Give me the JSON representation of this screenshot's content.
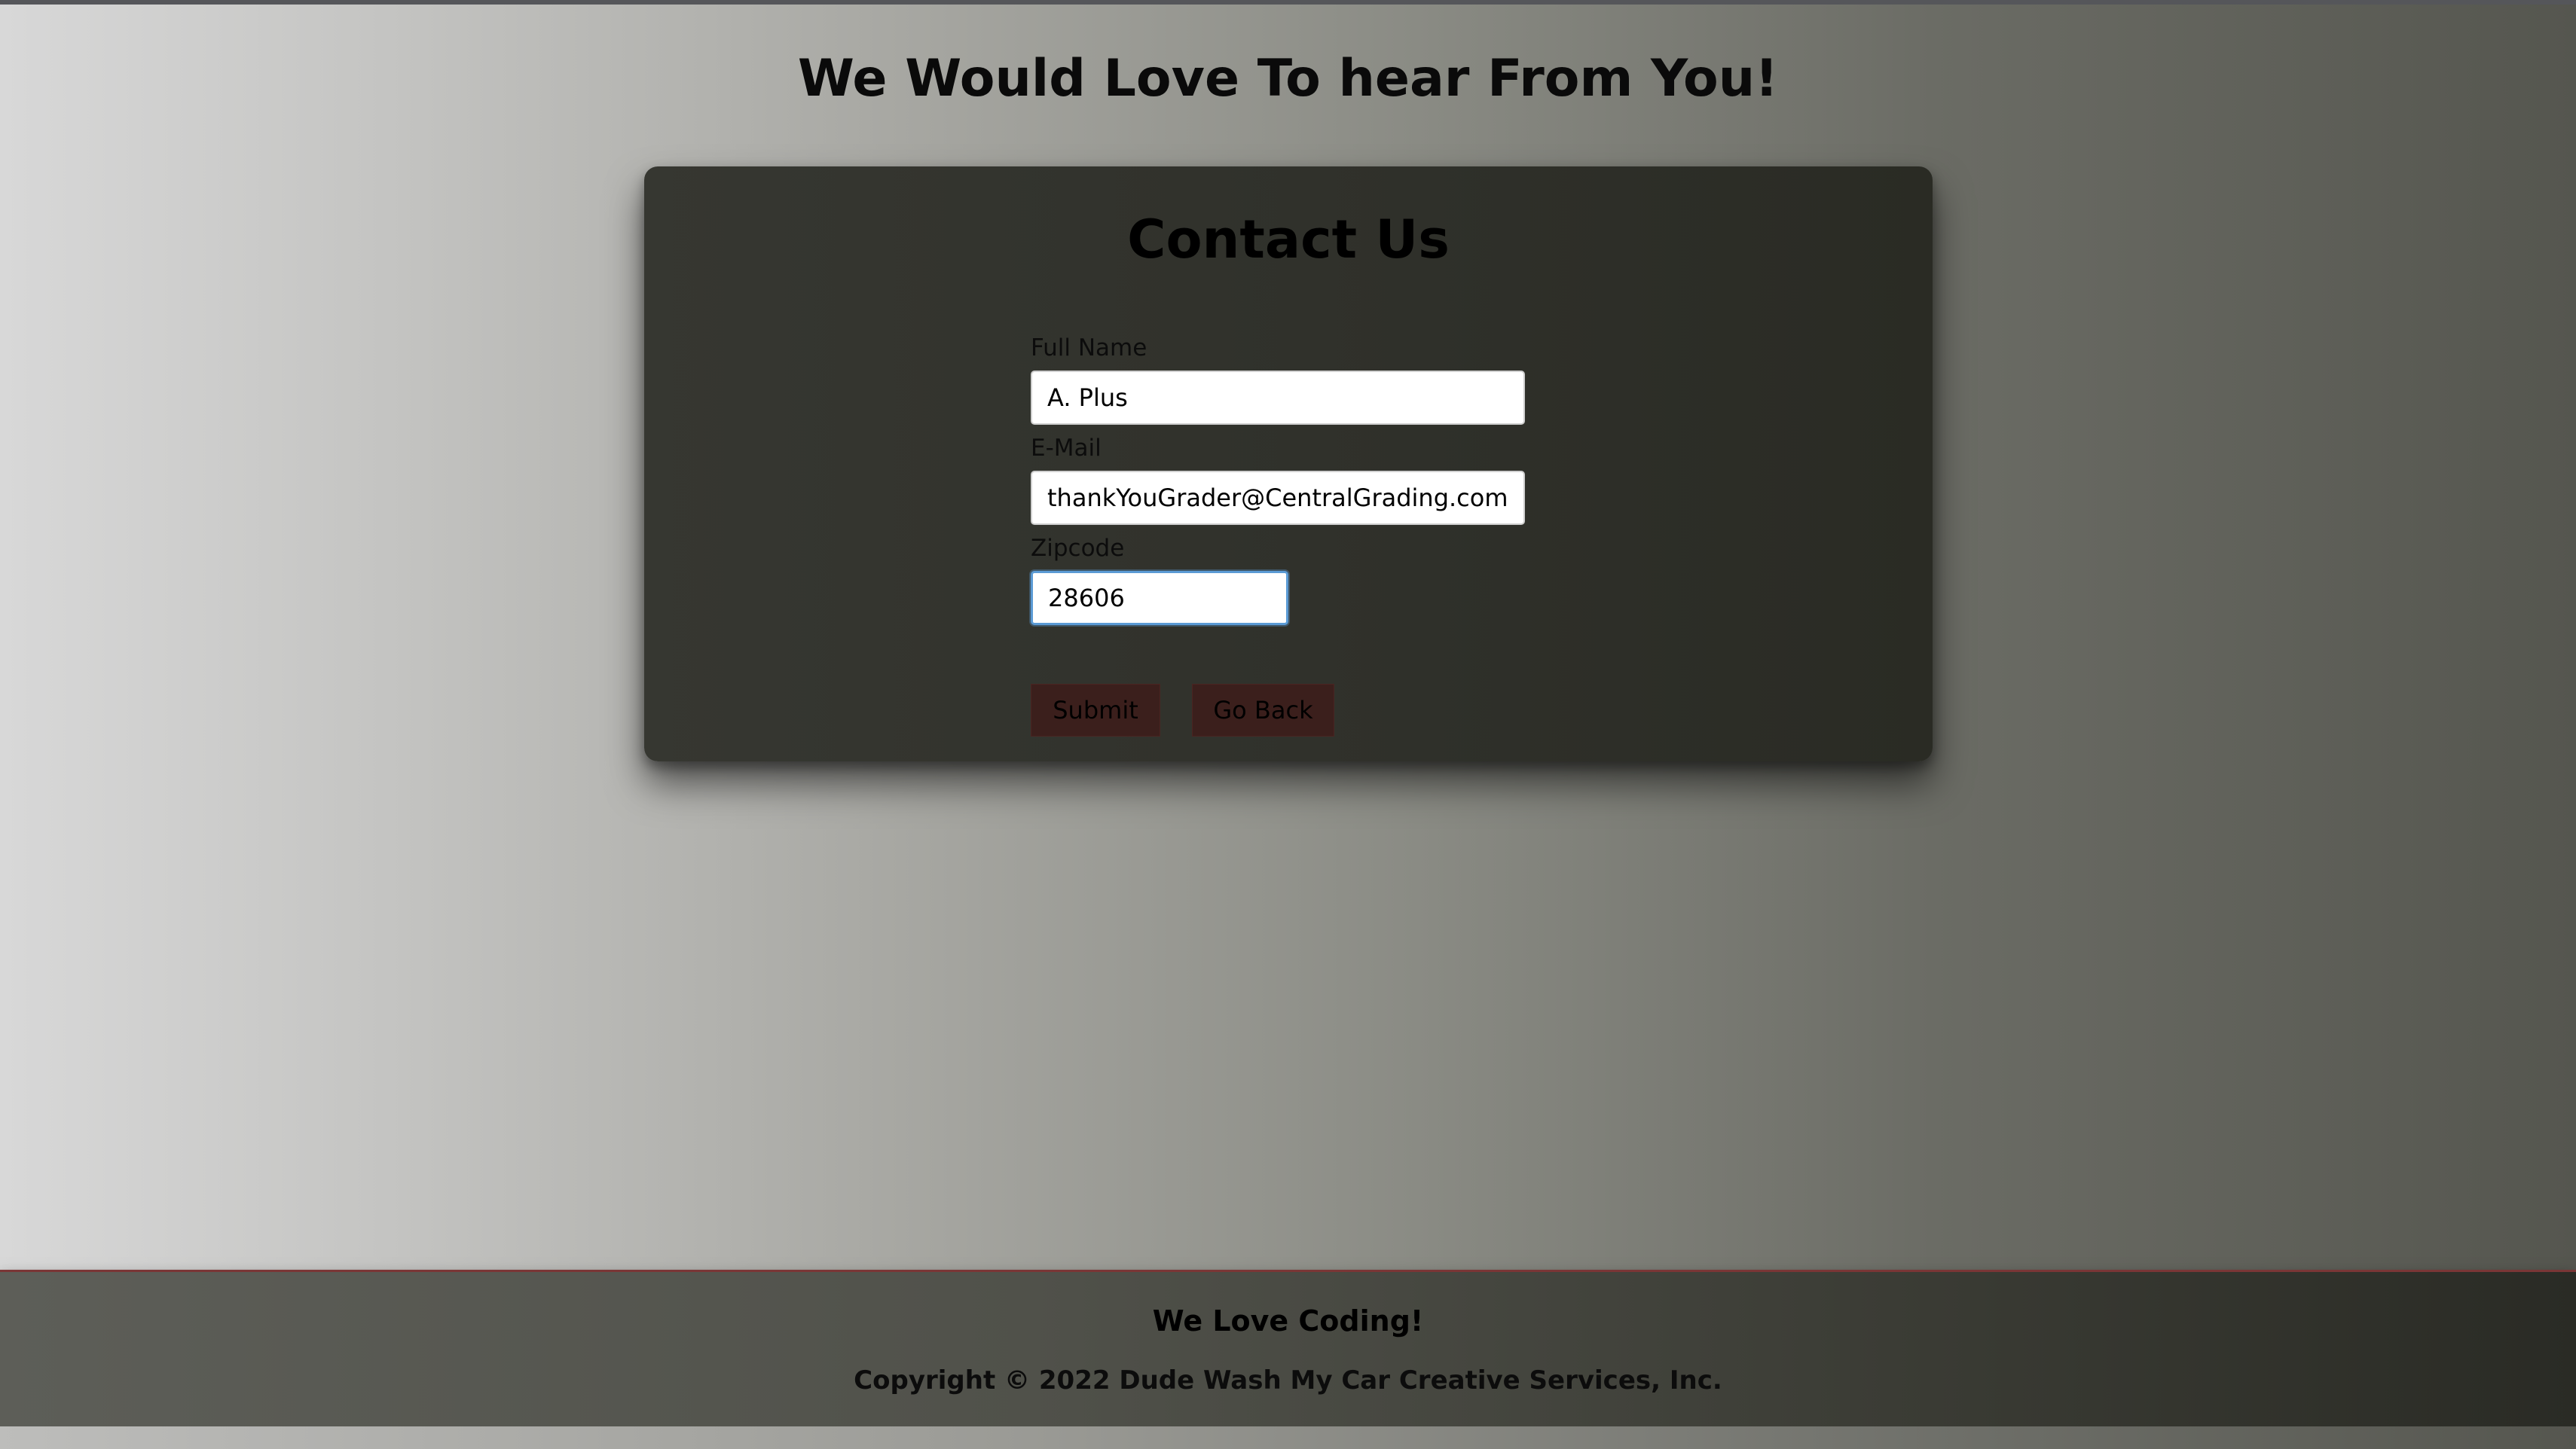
{
  "page": {
    "heading": "We Would Love To hear From You!"
  },
  "contact_form": {
    "title": "Contact Us",
    "full_name": {
      "label": "Full Name",
      "value": "A. Plus"
    },
    "email": {
      "label": "E-Mail",
      "value": "thankYouGrader@CentralGrading.com"
    },
    "zipcode": {
      "label": "Zipcode",
      "value": "28606"
    },
    "submit_label": "Submit",
    "back_label": "Go Back"
  },
  "footer": {
    "tagline": "We Love Coding!",
    "copyright": "Copyright © 2022 Dude Wash My Car Creative Services, Inc."
  },
  "colors": {
    "card_background": "#31322c",
    "button_background": "#3b1f1c",
    "footer_border": "#7a3636",
    "focus_ring": "#5b9bd5"
  }
}
